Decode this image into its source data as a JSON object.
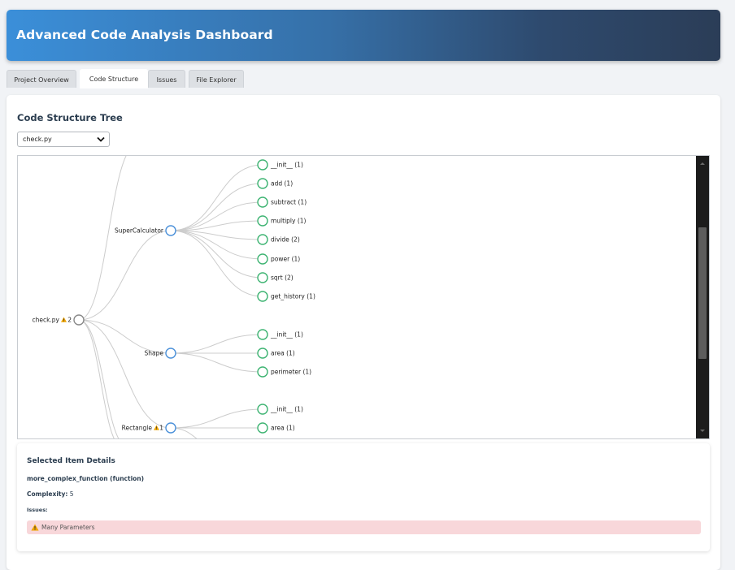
{
  "header": {
    "title": "Advanced Code Analysis Dashboard"
  },
  "tabs": [
    {
      "label": "Project Overview",
      "active": false
    },
    {
      "label": "Code Structure",
      "active": true
    },
    {
      "label": "Issues",
      "active": false
    },
    {
      "label": "File Explorer",
      "active": false
    }
  ],
  "panel": {
    "title": "Code Structure Tree",
    "file_select": {
      "value": "check.py",
      "icon": "chevron-down-icon"
    }
  },
  "tree": {
    "root": {
      "label": "check.py",
      "warning_icon": "warning-icon",
      "issue_count": "2"
    },
    "classes": [
      {
        "label": "SuperCalculator",
        "warning_count": "",
        "methods": [
          "__init__ (1)",
          "add (1)",
          "subtract (1)",
          "multiply (1)",
          "divide (2)",
          "power (1)",
          "sqrt (2)",
          "get_history (1)"
        ]
      },
      {
        "label": "Shape",
        "warning_count": "",
        "methods": [
          "__init__ (1)",
          "area (1)",
          "perimeter (1)"
        ]
      },
      {
        "label": "Rectangle",
        "warning_count": "1",
        "methods": [
          "__init__ (1)",
          "area (1)"
        ]
      }
    ],
    "colors": {
      "link": "#cccccc",
      "class_node": "#4a90d9",
      "method_node": "#3cb371",
      "root_node": "#888888",
      "warning": "#f0a500"
    }
  },
  "details": {
    "title": "Selected Item Details",
    "name": "more_complex_function (function)",
    "complexity_label": "Complexity:",
    "complexity_value": "5",
    "issues_label": "Issues:",
    "issues": [
      {
        "icon": "warning-icon",
        "text": "Many Parameters"
      }
    ]
  }
}
